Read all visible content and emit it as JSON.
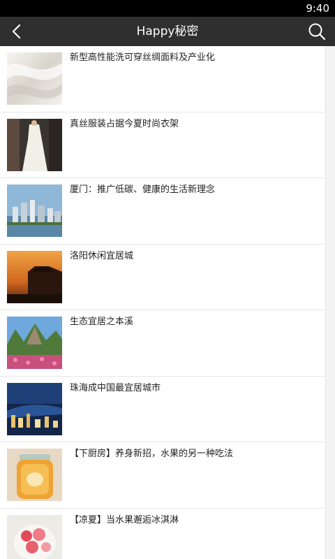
{
  "status_bar": {
    "time": "9:40"
  },
  "header": {
    "title": "Happy秘密",
    "back_icon": "back-arrow-icon",
    "search_icon": "search-icon"
  },
  "articles": [
    {
      "title": "新型高性能洗可穿丝绸面料及产业化"
    },
    {
      "title": "真丝服装占据今夏时尚衣架"
    },
    {
      "title": "厦门：推广低碳、健康的生活新理念"
    },
    {
      "title": "洛阳休闲宜居城"
    },
    {
      "title": "生态宜居之本溪"
    },
    {
      "title": "珠海成中国最宜居城市"
    },
    {
      "title": "【下厨房】养身新招，水果的另一种吃法"
    },
    {
      "title": "【凉夏】当水果邂逅冰淇淋"
    }
  ]
}
